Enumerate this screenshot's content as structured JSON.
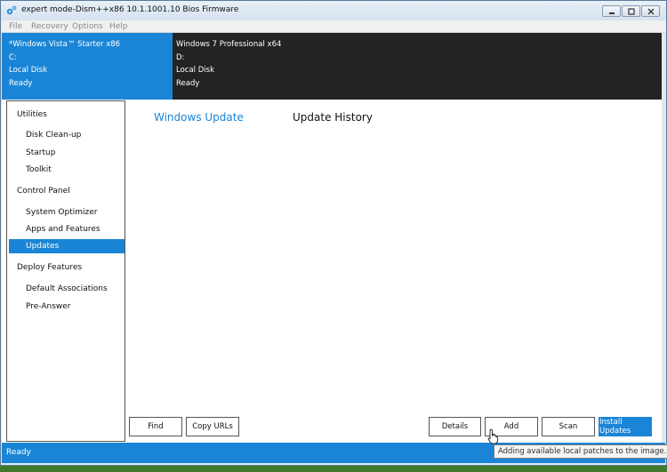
{
  "window": {
    "title": "expert mode-Dism++x86 10.1.1001.10 Bios Firmware"
  },
  "menu": [
    "File",
    "Recovery",
    "Options",
    "Help"
  ],
  "images": [
    {
      "name": "*Windows Vista™ Starter x86",
      "drive": "C:",
      "disk": "Local Disk",
      "status": "Ready",
      "selected": true
    },
    {
      "name": "Windows 7 Professional x64",
      "drive": "D:",
      "disk": "Local Disk",
      "status": "Ready",
      "selected": false
    }
  ],
  "sidebar": {
    "sections": [
      {
        "header": "Utilities",
        "items": [
          "Disk Clean-up",
          "Startup",
          "Toolkit"
        ]
      },
      {
        "header": "Control Panel",
        "items": [
          "System Optimizer",
          "Apps and Features",
          "Updates"
        ]
      },
      {
        "header": "Deploy Features",
        "items": [
          "Default Associations",
          "Pre-Answer"
        ]
      }
    ],
    "active_item": "Updates"
  },
  "main": {
    "tabs": [
      {
        "label": "Windows Update",
        "active": true
      },
      {
        "label": "Update History",
        "active": false
      }
    ]
  },
  "buttons": {
    "find": "Find",
    "copy_urls": "Copy URLs",
    "details": "Details",
    "add": "Add",
    "scan": "Scan",
    "install": "Install Updates"
  },
  "status": "Ready",
  "tooltip": "Adding available local patches to the image.",
  "colors": {
    "accent": "#1a85d6",
    "dark_panel": "#232323",
    "tab_active": "#1a85d6"
  }
}
